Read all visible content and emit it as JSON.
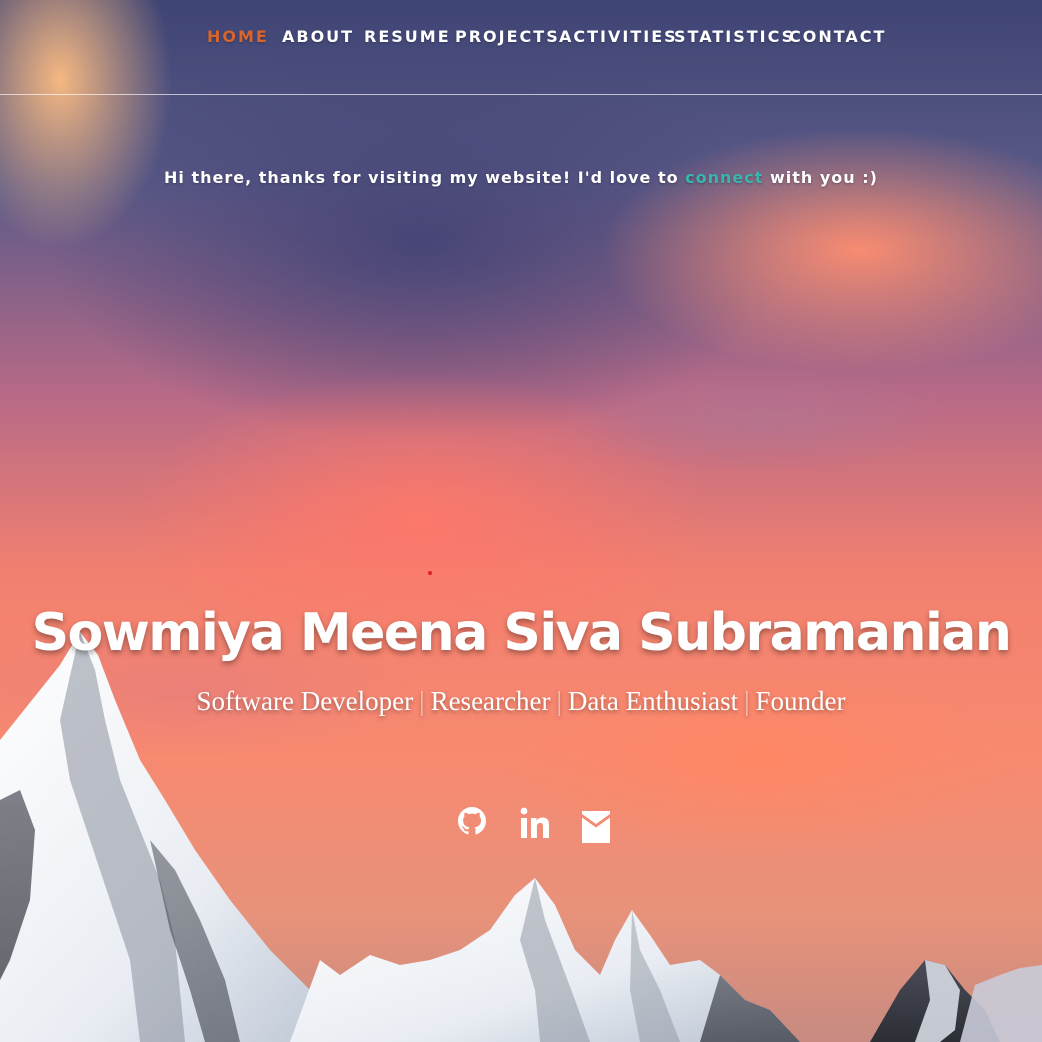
{
  "nav": {
    "items": [
      {
        "label": "HOME",
        "active": true
      },
      {
        "label": "ABOUT",
        "active": false
      },
      {
        "label": "RESUME",
        "active": false
      },
      {
        "label": "PROJECTS",
        "active": false
      },
      {
        "label": "ACTIVITIES",
        "active": false
      },
      {
        "label": "STATISTICS",
        "active": false
      },
      {
        "label": "CONTACT",
        "active": false
      }
    ]
  },
  "greeting": {
    "before": "Hi there, thanks for visiting my website! I'd love to ",
    "link": "connect",
    "after": " with you :)"
  },
  "hero": {
    "name": "Sowmiya Meena Siva Subramanian",
    "roles": [
      "Software Developer",
      "Researcher",
      "Data Enthusiast",
      "Founder"
    ],
    "separator": "|"
  },
  "social": [
    {
      "icon": "github-icon"
    },
    {
      "icon": "linkedin-icon"
    },
    {
      "icon": "envelope-icon"
    }
  ],
  "colors": {
    "active_nav": "#d9652b",
    "link": "#37b6b0",
    "text": "#ffffff"
  }
}
